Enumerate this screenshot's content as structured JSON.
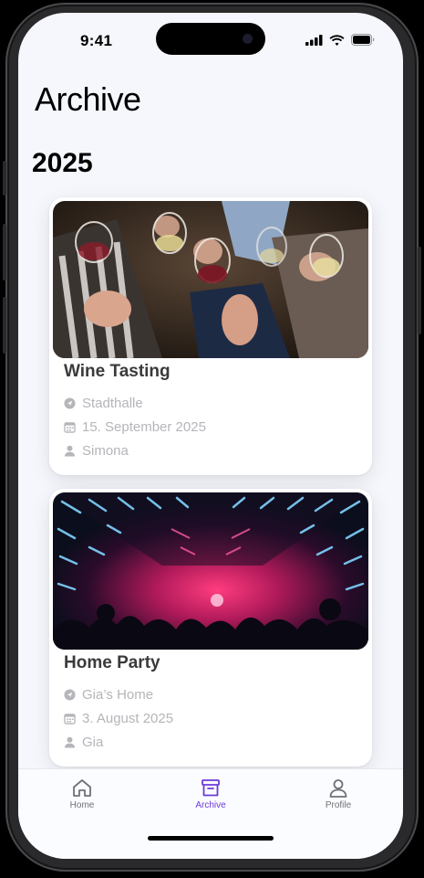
{
  "status": {
    "time": "9:41",
    "icons": [
      "cellular-signal-icon",
      "wifi-icon",
      "battery-icon"
    ]
  },
  "page": {
    "title": "Archive"
  },
  "sections": [
    {
      "year": "2025",
      "events": [
        {
          "title": "Wine Tasting",
          "image": "wine-glasses-toast-photo",
          "location": "Stadthalle",
          "date": "15. September 2025",
          "host": "Simona"
        },
        {
          "title": "Home Party",
          "image": "neon-party-hall-photo",
          "location": "Gia’s Home",
          "date": "3. August 2025",
          "host": "Gia"
        }
      ]
    }
  ],
  "tabs": [
    {
      "label": "Home",
      "icon": "house-icon",
      "active": false
    },
    {
      "label": "Archive",
      "icon": "archive-box-icon",
      "active": true
    },
    {
      "label": "Profile",
      "icon": "person-icon",
      "active": false
    }
  ],
  "colors": {
    "accent": "#6b3bd6",
    "screen_bg": "#f5f7fc",
    "secondary_text": "#b5b5ba"
  }
}
